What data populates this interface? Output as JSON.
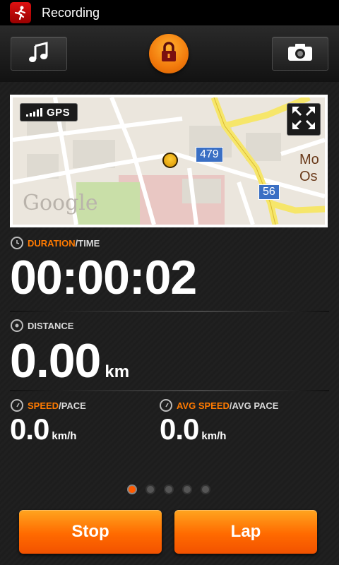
{
  "status_bar": {
    "title": "Recording",
    "app_icon": "runner-icon"
  },
  "toolbar": {
    "music_icon": "music-note-icon",
    "lock_icon": "lock-icon",
    "camera_icon": "camera-icon"
  },
  "map": {
    "gps_label": "GPS",
    "road_labels": [
      "479",
      "56"
    ],
    "place_label": "Mo\nOs",
    "attribution": "Google"
  },
  "duration": {
    "label_highlight": "DURATION",
    "label_rest": "/TIME",
    "value": "00:00:02"
  },
  "distance": {
    "label": "DISTANCE",
    "value": "0.00",
    "unit": "km"
  },
  "speed": {
    "label_highlight": "SPEED",
    "label_rest": "/PACE",
    "value": "0.0",
    "unit": "km/h"
  },
  "avg_speed": {
    "label_highlight": "AVG SPEED",
    "label_rest": "/AVG PACE",
    "value": "0.0",
    "unit": "km/h"
  },
  "pager": {
    "count": 5,
    "active_index": 0
  },
  "actions": {
    "stop_label": "Stop",
    "lap_label": "Lap"
  },
  "colors": {
    "accent": "#ff7a00",
    "button": "#ff6a00",
    "background": "#1b1b1b"
  }
}
